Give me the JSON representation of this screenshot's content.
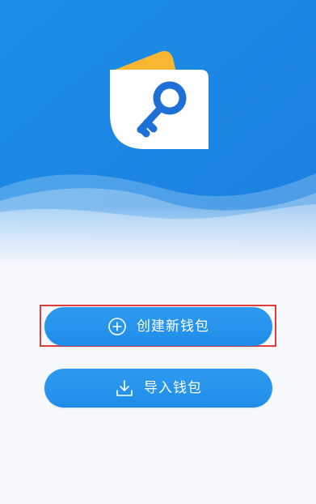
{
  "colors": {
    "hero_top": "#1c8fe6",
    "hero_bottom": "#1b7fe0",
    "button": "#2196f0",
    "card": "#ffffff",
    "wallet_back": "#f7b733",
    "key": "#1f6fd8",
    "highlight": "#e23b3b"
  },
  "icons": {
    "logo": "wallet-key-icon",
    "create": "plus-circle-icon",
    "import": "download-icon"
  },
  "actions": {
    "create_wallet_label": "创建新钱包",
    "import_wallet_label": "导入钱包"
  }
}
